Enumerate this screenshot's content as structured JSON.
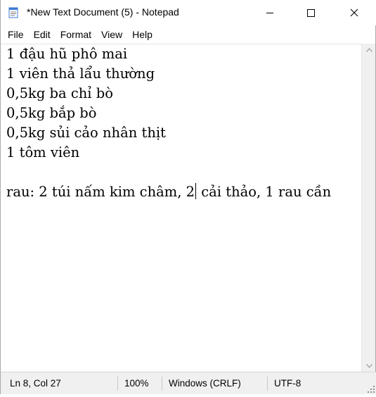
{
  "window": {
    "title": "*New Text Document (5) - Notepad",
    "app_icon": "notepad-icon"
  },
  "title_buttons": {
    "minimize": "minimize-icon",
    "maximize": "maximize-icon",
    "close": "close-icon"
  },
  "menu": [
    {
      "label": "File"
    },
    {
      "label": "Edit"
    },
    {
      "label": "Format"
    },
    {
      "label": "View"
    },
    {
      "label": "Help"
    }
  ],
  "editor": {
    "lines": [
      "1 đậu hũ phô mai",
      "1 viên thả lẩu thường",
      "0,5kg ba chỉ bò",
      "0,5kg bắp bò",
      "0,5kg sủi cảo nhân thịt",
      "1 tôm viên",
      "",
      "rau: 2 túi nấm kim châm, 2",
      " cải thảo, 1 rau cần"
    ]
  },
  "status": {
    "position": "Ln 8, Col 27",
    "zoom": "100%",
    "line_ending": "Windows (CRLF)",
    "encoding": "UTF-8"
  }
}
